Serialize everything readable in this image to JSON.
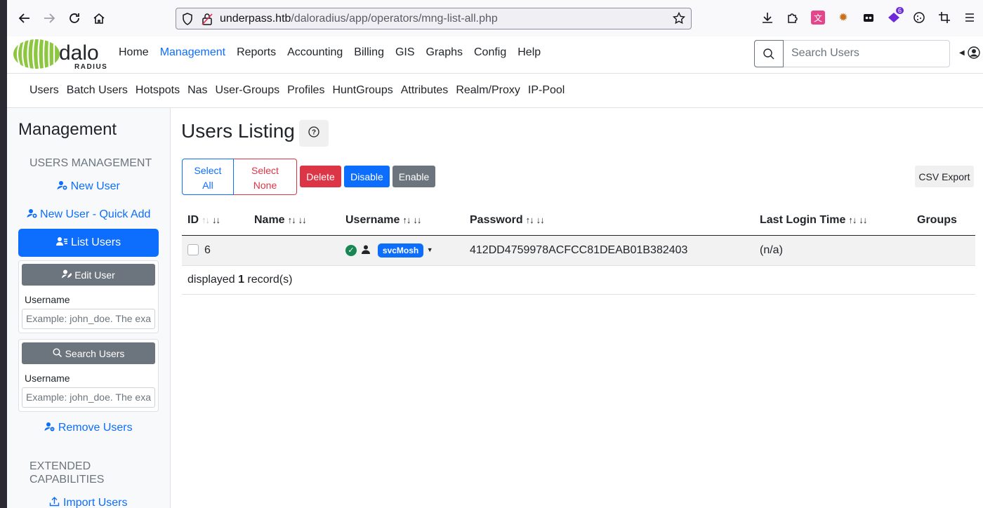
{
  "browser": {
    "url_domain": "underpass.htb",
    "url_path": "/daloradius/app/operators/mng-list-all.php"
  },
  "app": {
    "logo_text_top": "dalo",
    "logo_text_bottom": "RADIUS",
    "nav": [
      "Home",
      "Management",
      "Reports",
      "Accounting",
      "Billing",
      "GIS",
      "Graphs",
      "Config",
      "Help"
    ],
    "active_nav": "Management",
    "search_placeholder": "Search Users"
  },
  "subnav": [
    "Users",
    "Batch Users",
    "Hotspots",
    "Nas",
    "User-Groups",
    "Profiles",
    "HuntGroups",
    "Attributes",
    "Realm/Proxy",
    "IP-Pool"
  ],
  "sidebar": {
    "title": "Management",
    "section1": "USERS MANAGEMENT",
    "new_user": "New User",
    "new_user_quick": "New User - Quick Add",
    "list_users": "List Users",
    "edit_user_btn": "Edit User",
    "edit_username_label": "Username",
    "edit_username_placeholder": "Example: john_doe. The exa",
    "search_users_btn": "Search Users",
    "search_username_label": "Username",
    "search_username_placeholder": "Example: john_doe. The exa",
    "remove_users": "Remove Users",
    "section2_line1": "EXTENDED",
    "section2_line2": "CAPABILITIES",
    "import_users": "Import Users"
  },
  "main": {
    "title": "Users Listing",
    "help_icon": "?",
    "select_all_1": "Select",
    "select_all_2": "All",
    "select_none_1": "Select",
    "select_none_2": "None",
    "delete": "Delete",
    "disable": "Disable",
    "enable": "Enable",
    "csv_export": "CSV Export",
    "columns": {
      "id": "ID",
      "name": "Name",
      "username": "Username",
      "password": "Password",
      "last_login": "Last Login Time",
      "groups": "Groups"
    },
    "rows": [
      {
        "id": "6",
        "name": "",
        "username": "svcMosh",
        "password": "412DD4759978ACFCC81DEAB01B382403",
        "last_login": "(n/a)",
        "groups": ""
      }
    ],
    "footer_pre": "displayed",
    "footer_count": "1",
    "footer_post": "record(s)"
  },
  "colors": {
    "primary": "#0d6efd",
    "danger": "#dc3545",
    "secondary": "#6c757d",
    "success": "#198754",
    "logo_green": "#8dc63f"
  }
}
